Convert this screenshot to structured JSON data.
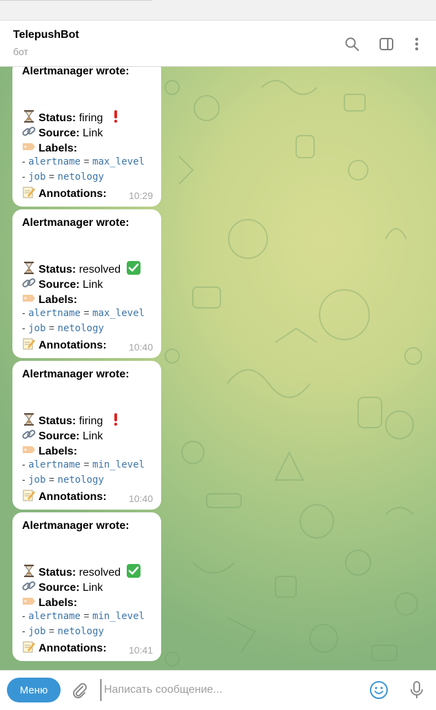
{
  "header": {
    "title": "TelepushBot",
    "subtitle": "бот",
    "icons": [
      "search-icon",
      "sidebar-toggle-icon",
      "more-vertical-icon"
    ]
  },
  "messages": [
    {
      "sender": "Alertmanager wrote:",
      "status_label": "Status:",
      "status_value": "firing",
      "status_emoji": "red-exclamation",
      "source_label": "Source:",
      "source_value": "Link",
      "labels_label": "Labels:",
      "dash": "-",
      "label1_key": "alertname",
      "label1_eq": "=",
      "label1_value": "max_level",
      "label2_key": "job",
      "label2_eq": "=",
      "label2_value": "netology",
      "annotations_label": "Annotations:",
      "time": "10:29"
    },
    {
      "sender": "Alertmanager wrote:",
      "status_label": "Status:",
      "status_value": "resolved",
      "status_emoji": "green-check",
      "source_label": "Source:",
      "source_value": "Link",
      "labels_label": "Labels:",
      "dash": "-",
      "label1_key": "alertname",
      "label1_eq": "=",
      "label1_value": "max_level",
      "label2_key": "job",
      "label2_eq": "=",
      "label2_value": "netology",
      "annotations_label": "Annotations:",
      "time": "10:40"
    },
    {
      "sender": "Alertmanager wrote:",
      "status_label": "Status:",
      "status_value": "firing",
      "status_emoji": "red-exclamation",
      "source_label": "Source:",
      "source_value": "Link",
      "labels_label": "Labels:",
      "dash": "-",
      "label1_key": "alertname",
      "label1_eq": "=",
      "label1_value": "min_level",
      "label2_key": "job",
      "label2_eq": "=",
      "label2_value": "netology",
      "annotations_label": "Annotations:",
      "time": "10:40"
    },
    {
      "sender": "Alertmanager wrote:",
      "status_label": "Status:",
      "status_value": "resolved",
      "status_emoji": "green-check",
      "source_label": "Source:",
      "source_value": "Link",
      "labels_label": "Labels:",
      "dash": "-",
      "label1_key": "alertname",
      "label1_eq": "=",
      "label1_value": "min_level",
      "label2_key": "job",
      "label2_eq": "=",
      "label2_value": "netology",
      "annotations_label": "Annotations:",
      "time": "10:41"
    }
  ],
  "composer": {
    "menu_label": "Меню",
    "placeholder": "Написать сообщение...",
    "icons": [
      "paperclip-icon",
      "emoji-icon",
      "microphone-icon"
    ]
  },
  "colors": {
    "accent": "#3a95d6",
    "link": "#3a74a8",
    "wallpaper_light": "#d7dd92",
    "wallpaper_dark": "#86b47c"
  }
}
